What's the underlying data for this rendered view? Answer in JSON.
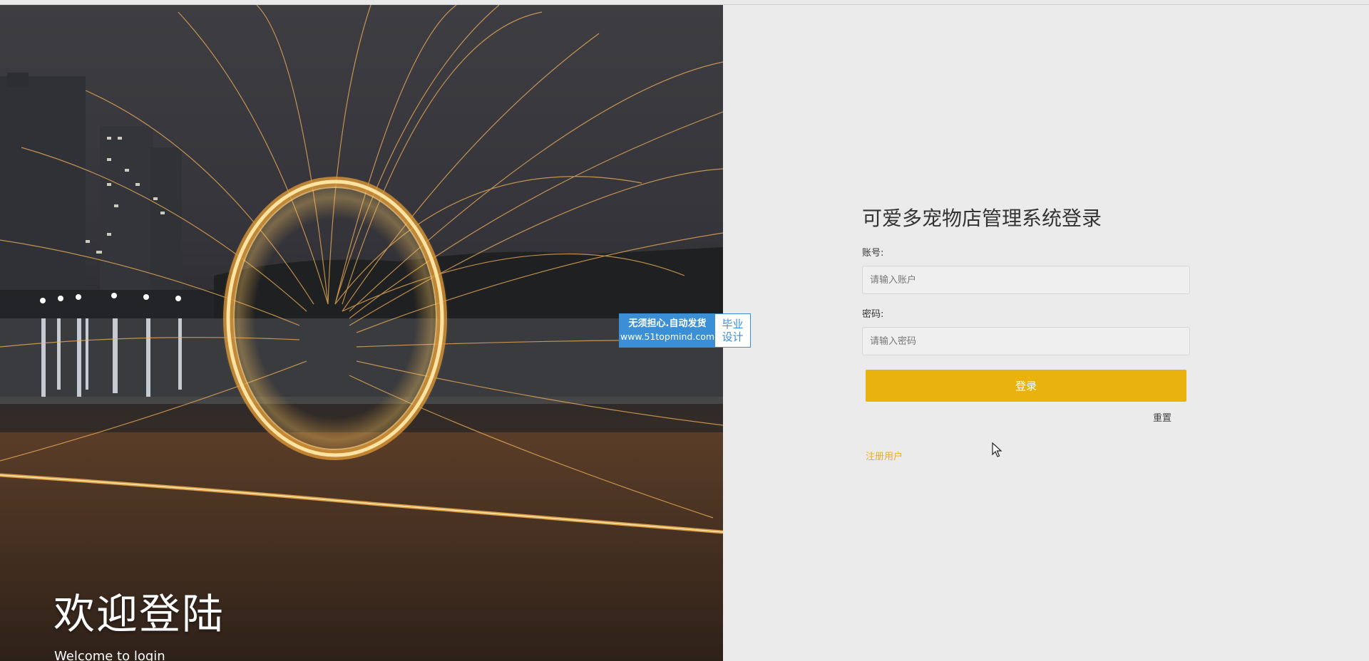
{
  "hero": {
    "title": "欢迎登陆",
    "subtitle": "Welcome to login"
  },
  "watermark": {
    "line1": "无须担心.自动发货",
    "line2": "www.51topmind.com",
    "right_line1": "毕业",
    "right_line2": "设计"
  },
  "login": {
    "title": "可爱多宠物店管理系统登录",
    "account_label": "账号:",
    "account_placeholder": "请输入账户",
    "account_value": "",
    "password_label": "密码:",
    "password_placeholder": "请输入密码",
    "password_value": "",
    "login_button": "登录",
    "reset_link": "重置",
    "register_link": "注册用户"
  },
  "colors": {
    "accent": "#eab20e",
    "panel_bg": "#ebebeb",
    "watermark_blue": "#3b8fd6"
  },
  "icons": {
    "cursor": "mouse-pointer-icon"
  }
}
